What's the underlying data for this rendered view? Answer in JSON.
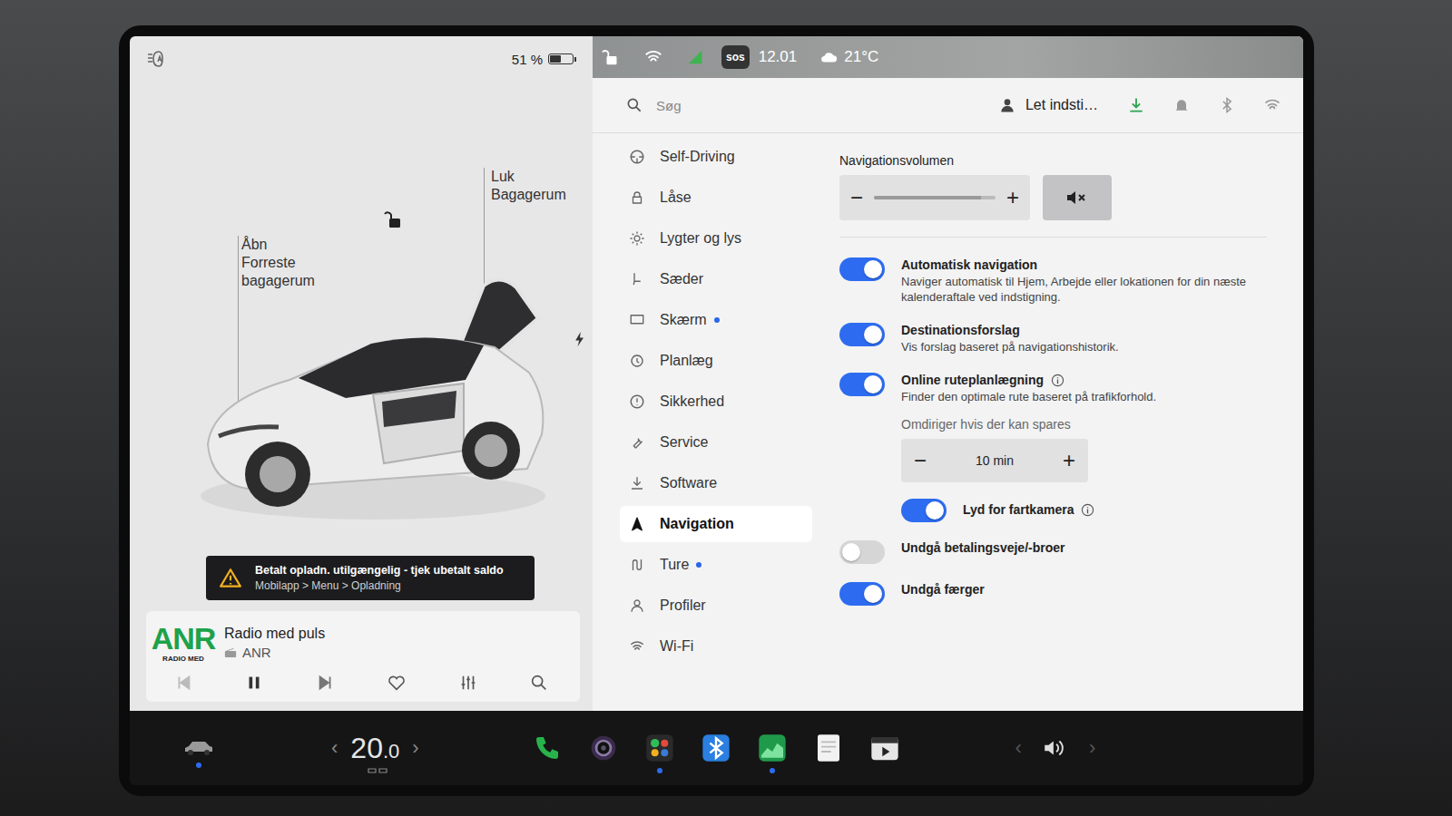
{
  "status": {
    "battery": "51 %",
    "battery_level": 0.51,
    "sos": "sos",
    "time": "12.01",
    "temperature": "21°C"
  },
  "car": {
    "locked": false,
    "trunk_open": true,
    "labels": [
      {
        "lines": [
          "Åbn",
          "Forreste",
          "bagagerum"
        ]
      },
      {
        "lines": [
          "Luk",
          "Bagagerum"
        ]
      }
    ]
  },
  "alert": {
    "title": "Betalt opladn. utilgængelig - tjek ubetalt saldo",
    "subtitle": "Mobilapp > Menu > Opladning"
  },
  "media": {
    "logo": "ANR",
    "logo_caption": "RADIO MED",
    "title": "Radio med puls",
    "station": "ANR",
    "playing": true,
    "favorite": false
  },
  "search": {
    "placeholder": "Søg"
  },
  "profile": {
    "name": "Let indsti…"
  },
  "menu": [
    {
      "label": "Self-Driving",
      "selected": false,
      "badge": false
    },
    {
      "label": "Låse",
      "selected": false,
      "badge": false
    },
    {
      "label": "Lygter og lys",
      "selected": false,
      "badge": false
    },
    {
      "label": "Sæder",
      "selected": false,
      "badge": false
    },
    {
      "label": "Skærm",
      "selected": false,
      "badge": true
    },
    {
      "label": "Planlæg",
      "selected": false,
      "badge": false
    },
    {
      "label": "Sikkerhed",
      "selected": false,
      "badge": false
    },
    {
      "label": "Service",
      "selected": false,
      "badge": false
    },
    {
      "label": "Software",
      "selected": false,
      "badge": false
    },
    {
      "label": "Navigation",
      "selected": true,
      "badge": false
    },
    {
      "label": "Ture",
      "selected": false,
      "badge": true
    },
    {
      "label": "Profiler",
      "selected": false,
      "badge": false
    },
    {
      "label": "Wi-Fi",
      "selected": false,
      "badge": false
    }
  ],
  "settings": {
    "volume": {
      "label": "Navigationsvolumen",
      "minus": "−",
      "plus": "+",
      "level": 0.88,
      "muted": true
    },
    "items": [
      {
        "kind": "toggle",
        "title": "Automatisk navigation",
        "on": true,
        "info": false,
        "description": "Naviger automatisk til Hjem, Arbejde eller lokationen for din næste kalenderaftale ved indstigning."
      },
      {
        "kind": "toggle",
        "title": "Destinationsforslag",
        "on": true,
        "info": false,
        "description": "Vis forslag baseret på navigationshistorik."
      },
      {
        "kind": "toggle",
        "title": "Online ruteplanlægning",
        "on": true,
        "info": true,
        "description": "Finder den optimale rute baseret på trafikforhold."
      },
      {
        "kind": "stepper",
        "label": "Omdiriger hvis der kan spares",
        "minus": "−",
        "value": "10 min",
        "plus": "+"
      },
      {
        "kind": "subtoggle",
        "title": "Lyd for fartkamera",
        "on": true,
        "info": true
      },
      {
        "kind": "toggle",
        "title": "Undgå betalingsveje/-broer",
        "on": false,
        "info": false
      },
      {
        "kind": "toggle",
        "title": "Undgå færger",
        "on": true,
        "info": false
      }
    ]
  },
  "taskbar": {
    "car_active": true,
    "temperature_whole": "20",
    "temperature_decimal": ".0",
    "prev": "‹",
    "next": "›",
    "apps": [
      {
        "active": false
      },
      {
        "active": false
      },
      {
        "active": true
      },
      {
        "active": false
      },
      {
        "active": true
      },
      {
        "active": false
      },
      {
        "active": false
      }
    ],
    "volume_prev": "‹",
    "volume_next": "›"
  }
}
